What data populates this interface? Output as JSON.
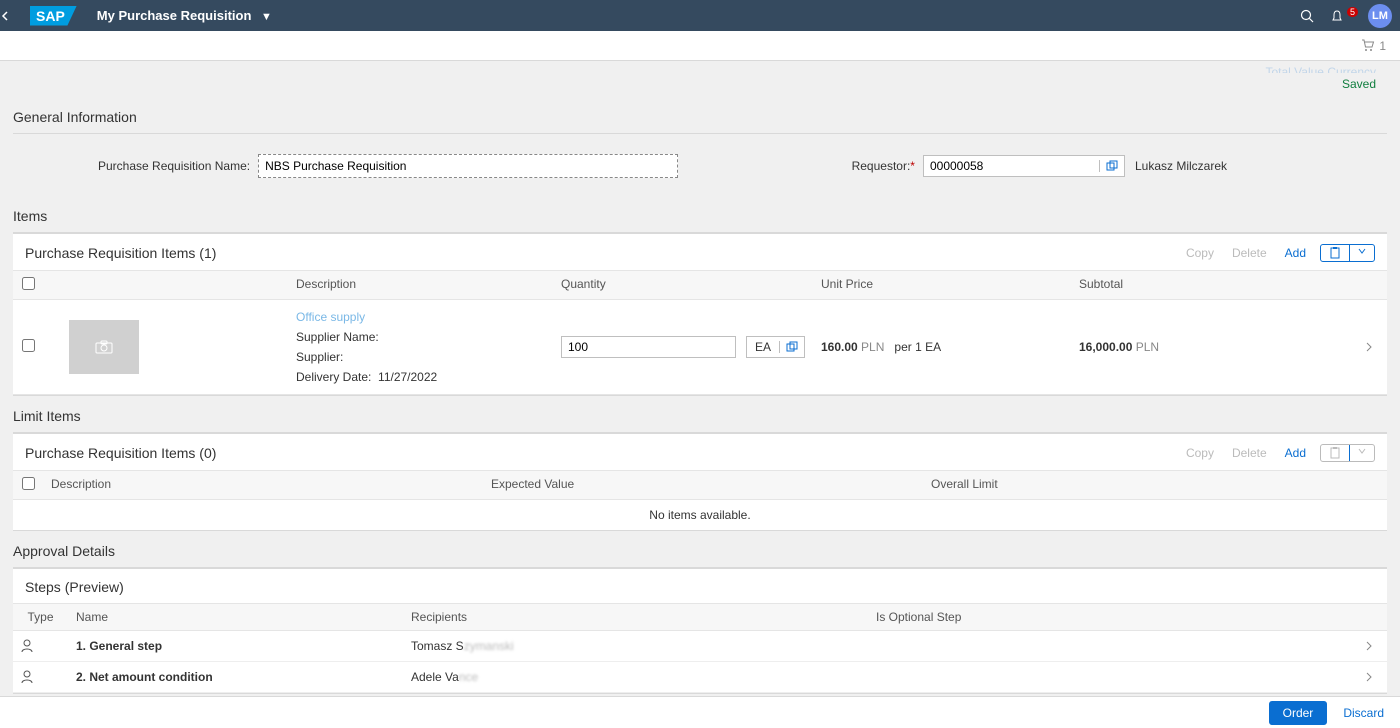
{
  "header": {
    "app_title": "My Purchase Requisition",
    "notification_count": "5",
    "avatar_initials": "LM",
    "cart_count": "1"
  },
  "status": {
    "top_text": "Total Value Currency",
    "saved": "Saved"
  },
  "general": {
    "section_title": "General Information",
    "name_label": "Purchase Requisition Name:",
    "name_value": "NBS Purchase Requisition",
    "requestor_label": "Requestor:",
    "requestor_value": "00000058",
    "requestor_name": "Lukasz Milczarek"
  },
  "items_section": {
    "title": "Items",
    "table_title": "Purchase Requisition Items (1)",
    "actions": {
      "copy": "Copy",
      "delete": "Delete",
      "add": "Add"
    },
    "columns": {
      "description": "Description",
      "quantity": "Quantity",
      "unit_price": "Unit Price",
      "subtotal": "Subtotal"
    },
    "rows": [
      {
        "desc_link": "Office supply",
        "supplier_name_label": "Supplier Name:",
        "supplier_label": "Supplier:",
        "delivery_date_label": "Delivery Date:",
        "delivery_date": "11/27/2022",
        "qty": "100",
        "unit": "EA",
        "unit_price_value": "160.00",
        "unit_price_currency": "PLN",
        "unit_price_per": "per 1 EA",
        "subtotal_value": "16,000.00",
        "subtotal_currency": "PLN"
      }
    ]
  },
  "limit_section": {
    "title": "Limit Items",
    "table_title": "Purchase Requisition Items (0)",
    "actions": {
      "copy": "Copy",
      "delete": "Delete",
      "add": "Add"
    },
    "columns": {
      "description": "Description",
      "expected": "Expected Value",
      "overall": "Overall Limit"
    },
    "empty_text": "No items available."
  },
  "approval": {
    "title": "Approval Details",
    "table_title": "Steps (Preview)",
    "columns": {
      "type": "Type",
      "name": "Name",
      "recipients": "Recipients",
      "optional": "Is Optional Step"
    },
    "rows": [
      {
        "name": "1. General step",
        "recip_clear": "Tomasz S",
        "recip_blur": "zymanski"
      },
      {
        "name": "2. Net amount condition",
        "recip_clear": "Adele Va",
        "recip_blur": "nce"
      }
    ]
  },
  "footer": {
    "order": "Order",
    "discard": "Discard"
  }
}
